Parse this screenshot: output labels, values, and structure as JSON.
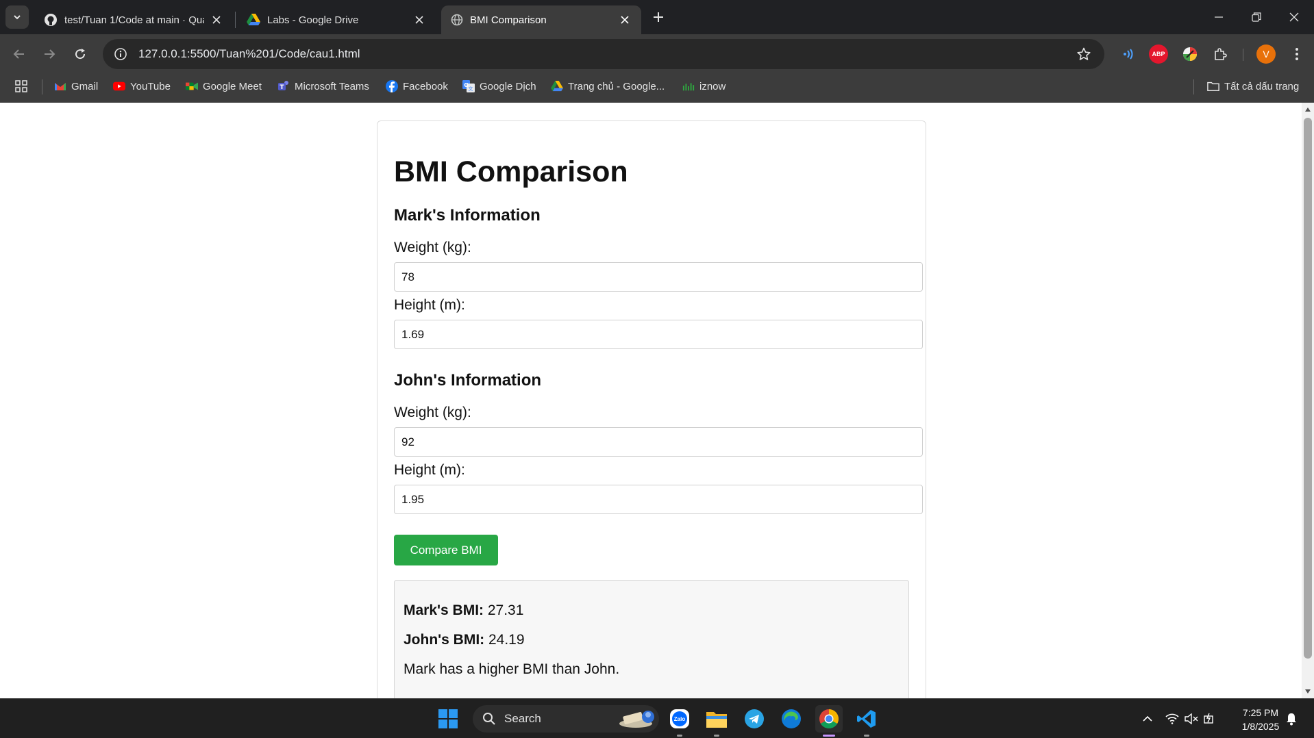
{
  "browser": {
    "tabs": [
      {
        "title": "test/Tuan 1/Code at main · Qua",
        "icon": "github-icon",
        "active": false
      },
      {
        "title": "Labs - Google Drive",
        "icon": "google-drive-icon",
        "active": false
      },
      {
        "title": "BMI Comparison",
        "icon": "globe-icon",
        "active": true
      }
    ],
    "url": "127.0.0.1:5500/Tuan%201/Code/cau1.html",
    "profile_initial": "V",
    "abp_label": "ABP",
    "bookmarks": [
      {
        "label": "Gmail",
        "icon": "gmail-icon"
      },
      {
        "label": "YouTube",
        "icon": "youtube-icon"
      },
      {
        "label": "Google Meet",
        "icon": "google-meet-icon"
      },
      {
        "label": "Microsoft Teams",
        "icon": "teams-icon"
      },
      {
        "label": "Facebook",
        "icon": "facebook-icon"
      },
      {
        "label": "Google Dịch",
        "icon": "google-translate-icon"
      },
      {
        "label": "Trang chủ - Google...",
        "icon": "google-drive-icon"
      },
      {
        "label": "iznow",
        "icon": "iznow-icon"
      }
    ],
    "all_bookmarks_label": "Tất cả dấu trang"
  },
  "page": {
    "title": "BMI Comparison",
    "mark": {
      "heading": "Mark's Information",
      "weight_label": "Weight (kg):",
      "weight_value": "78",
      "height_label": "Height (m):",
      "height_value": "1.69"
    },
    "john": {
      "heading": "John's Information",
      "weight_label": "Weight (kg):",
      "weight_value": "92",
      "height_label": "Height (m):",
      "height_value": "1.95"
    },
    "compare_button": "Compare BMI",
    "result": {
      "mark_label": "Mark's BMI:",
      "mark_value": " 27.31",
      "john_label": "John's BMI:",
      "john_value": " 24.19",
      "message": "Mark has a higher BMI than John."
    }
  },
  "taskbar": {
    "search_label": "Search",
    "time": "7:25 PM",
    "date": "1/8/2025",
    "zalo_label": "Zalo"
  },
  "colors": {
    "compare_button": "#28a745",
    "chrome_dark": "#202124",
    "chrome_toolbar": "#3c3c3c"
  }
}
